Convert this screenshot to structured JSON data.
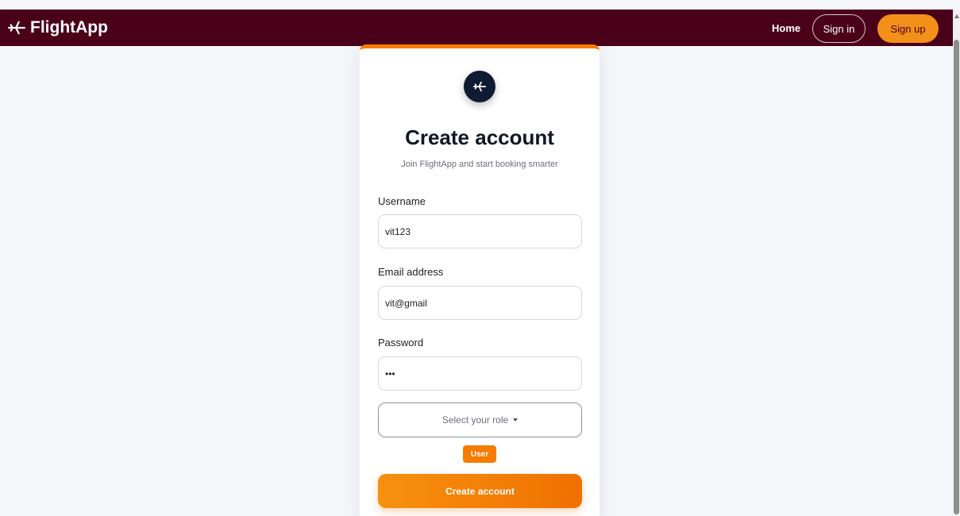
{
  "navbar": {
    "brand": "FlightApp",
    "home": "Home",
    "signin": "Sign in",
    "signup": "Sign up"
  },
  "form": {
    "title": "Create account",
    "subtitle": "Join FlightApp and start booking smarter",
    "username": {
      "label": "Username",
      "value": "vit123"
    },
    "email": {
      "label": "Email address",
      "value": "vit@gmail"
    },
    "password": {
      "label": "Password",
      "value": "•••"
    },
    "role_select": "Select your role",
    "selected_role": "User",
    "submit": "Create account"
  },
  "colors": {
    "navbar": "#4a0019",
    "accent": "#f57c00",
    "logo_circle": "#0f1b33"
  }
}
